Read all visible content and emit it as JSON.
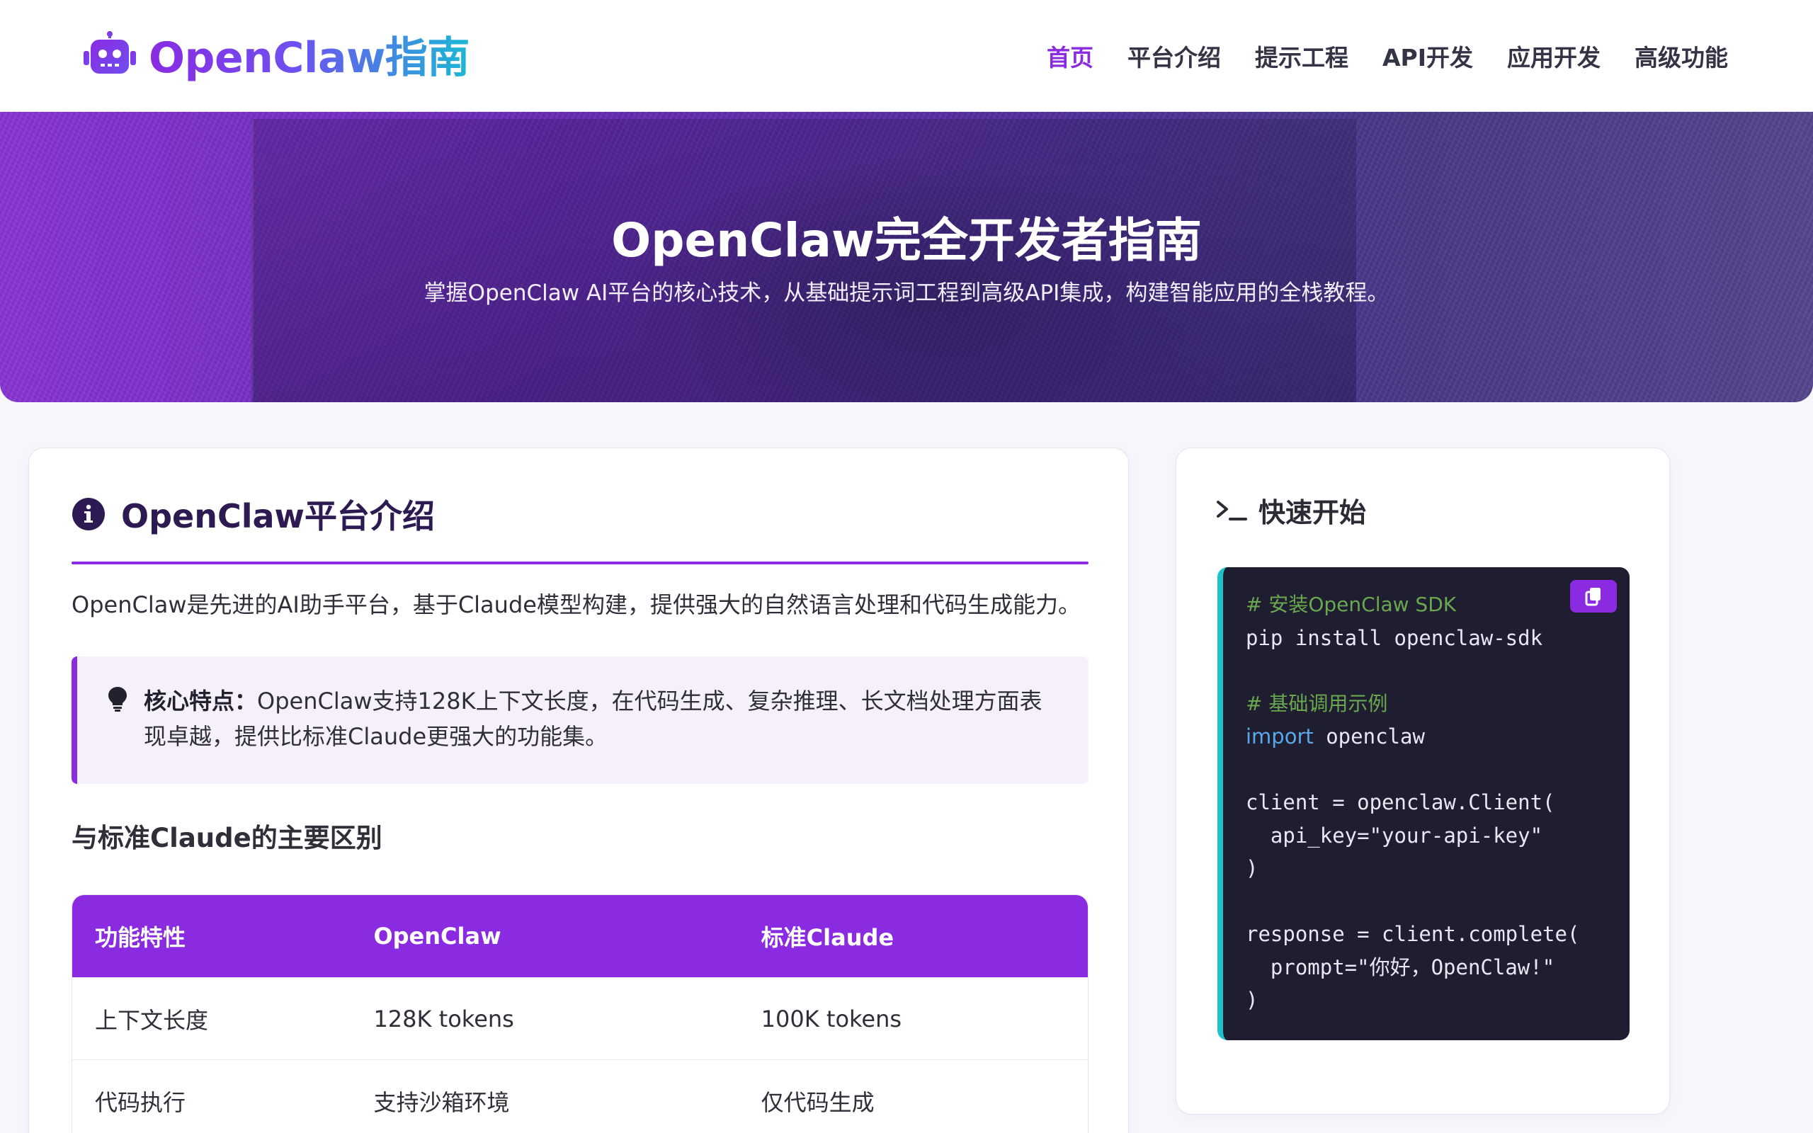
{
  "brand": {
    "name": "OpenClaw指南",
    "icon": "robot-icon"
  },
  "nav": {
    "items": [
      {
        "label": "首页",
        "active": true
      },
      {
        "label": "平台介绍",
        "active": false
      },
      {
        "label": "提示工程",
        "active": false
      },
      {
        "label": "API开发",
        "active": false
      },
      {
        "label": "应用开发",
        "active": false
      },
      {
        "label": "高级功能",
        "active": false
      }
    ]
  },
  "hero": {
    "title": "OpenClaw完全开发者指南",
    "subtitle": "掌握OpenClaw AI平台的核心技术，从基础提示词工程到高级API集成，构建智能应用的全栈教程。"
  },
  "platform": {
    "title": "OpenClaw平台介绍",
    "icon": "info-icon",
    "intro": "OpenClaw是先进的AI助手平台，基于Claude模型构建，提供强大的自然语言处理和代码生成能力。",
    "callout_label": "核心特点：",
    "callout_text": "OpenClaw支持128K上下文长度，在代码生成、复杂推理、长文档处理方面表现卓越，提供比标准Claude更强大的功能集。",
    "comparison_heading": "与标准Claude的主要区别",
    "table": {
      "headers": [
        "功能特性",
        "OpenClaw",
        "标准Claude"
      ],
      "rows": [
        [
          "上下文长度",
          "128K tokens",
          "100K tokens"
        ],
        [
          "代码执行",
          "支持沙箱环境",
          "仅代码生成"
        ]
      ]
    }
  },
  "quickstart": {
    "title": "快速开始",
    "icon": "terminal-icon",
    "copy_icon": "copy-icon",
    "code": {
      "comment_install": "# 安装OpenClaw SDK",
      "line_pip": "pip install openclaw-sdk",
      "comment_basic": "# 基础调用示例",
      "kw_import": "import",
      "import_target": " openclaw",
      "line_client": "client = openclaw.Client(",
      "line_apikey": "  api_key=\"your-api-key\"",
      "line_close1": ")",
      "line_response": "response = client.complete(",
      "line_prompt": "  prompt=\"你好，OpenClaw!\"",
      "line_close2": ")"
    }
  },
  "colors": {
    "accent": "#8a2be2",
    "code_bg": "#1f1d30",
    "code_border": "#1cc2c9",
    "comment": "#6aa84f",
    "keyword": "#5aa7ea"
  }
}
